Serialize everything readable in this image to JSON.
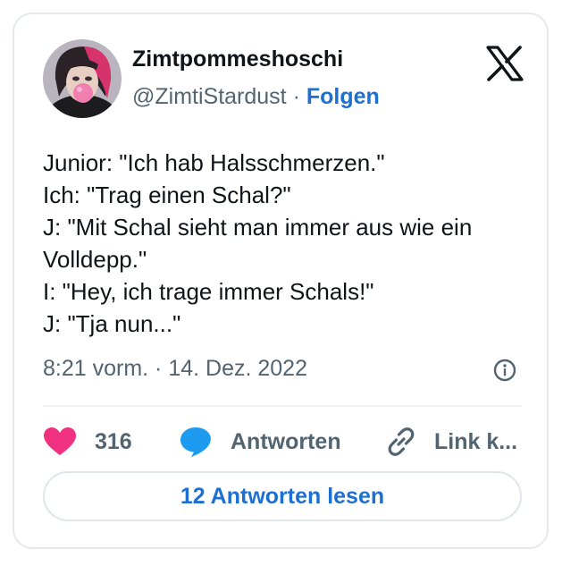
{
  "author": {
    "display_name": "Zimtpommeshoschi",
    "handle": "@ZimtiStardust",
    "separator": " · ",
    "follow_label": "Folgen"
  },
  "tweet": {
    "lines": [
      "Junior: \"Ich hab Halsschmerzen.\"",
      "Ich: \"Trag einen Schal?\"",
      "J: \"Mit Schal sieht man immer aus wie ein",
      "Volldepp.\"",
      "I: \"Hey, ich trage immer Schals!\"",
      "J: \"Tja nun...\""
    ],
    "timestamp": "8:21 vorm. · 14. Dez. 2022"
  },
  "actions": {
    "like_count": "316",
    "reply_label": "Antworten",
    "link_label": "Link k..."
  },
  "read_replies_label": "12 Antworten lesen",
  "icons": {
    "logo": "x-logo-icon",
    "info": "info-icon",
    "like": "heart-icon",
    "reply": "speech-bubble-icon",
    "link": "link-icon"
  },
  "colors": {
    "accent_blue": "#1d6fd1",
    "heart_pink": "#f0317f",
    "reply_blue": "#1d9bf0",
    "secondary_text": "#536471"
  }
}
